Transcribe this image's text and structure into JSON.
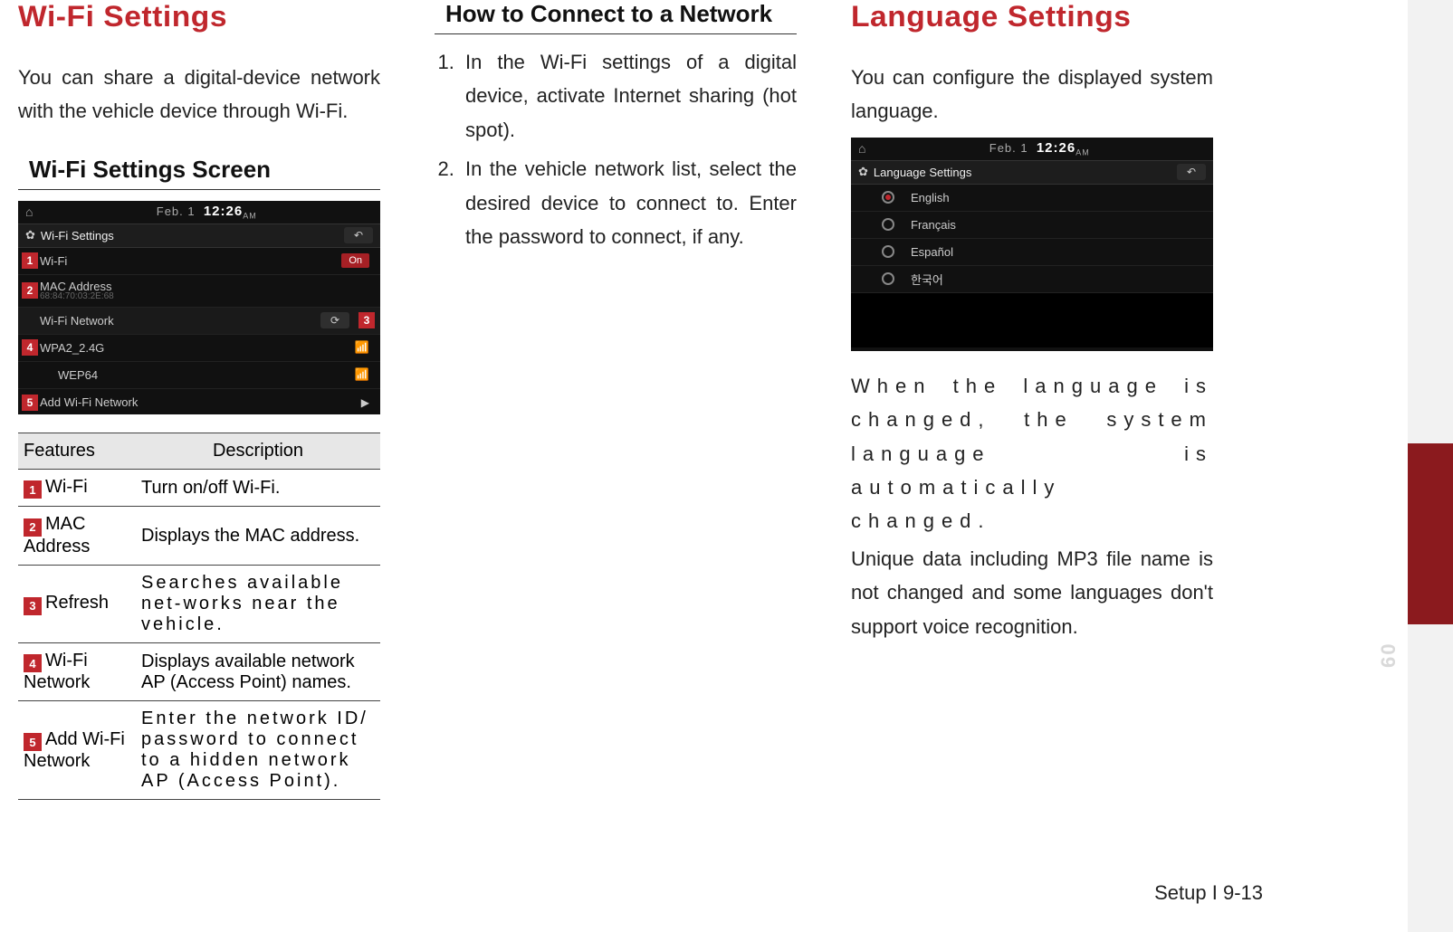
{
  "col1": {
    "title": "Wi-Fi Settings",
    "intro": "You can share a digital-device network with the vehicle device through Wi-Fi.",
    "subheading": "Wi-Fi Settings Screen",
    "screenshot": {
      "date_prefix": "Feb.  1",
      "time": "12:26",
      "time_suffix": "AM",
      "title": "Wi-Fi Settings",
      "row_wifi": "Wi-Fi",
      "wifi_state": "On",
      "row_mac": "MAC Address",
      "mac_value": "68:84:70:03:2E:68",
      "network_header": "Wi-Fi Network",
      "net1": "WPA2_2.4G",
      "net2": "WEP64",
      "add": "Add Wi-Fi Network"
    },
    "table": {
      "head_features": "Features",
      "head_desc": "Description",
      "rows": [
        {
          "num": "1",
          "feature": "Wi-Fi",
          "desc": "Turn on/off Wi-Fi."
        },
        {
          "num": "2",
          "feature": "MAC Address",
          "desc": "Displays the MAC address."
        },
        {
          "num": "3",
          "feature": "Refresh",
          "desc": "Searches available net-works near the vehicle."
        },
        {
          "num": "4",
          "feature": "Wi-Fi Network",
          "desc": "Displays available network AP (Access Point) names."
        },
        {
          "num": "5",
          "feature": "Add Wi-Fi Network",
          "desc": "Enter the network ID/ password to connect to a hidden network AP (Access Point)."
        }
      ]
    }
  },
  "col2": {
    "subheading": "How to Connect to a Network",
    "steps": [
      "In the Wi-Fi settings of a digital device, activate Internet sharing (hot spot).",
      "In the vehicle network list, select the desired device to connect to. Enter the password to connect, if any."
    ]
  },
  "col3": {
    "title": "Language Settings",
    "intro": "You can configure the displayed system language.",
    "screenshot": {
      "date_prefix": "Feb.  1",
      "time": "12:26",
      "time_suffix": "AM",
      "title": "Language Settings",
      "opts": [
        "English",
        "Français",
        "Español",
        "한국어"
      ]
    },
    "body1": "When the language is changed, the system language is automatically changed.",
    "body2": "Unique data including MP3 file name is not changed and some languages don't support voice recognition."
  },
  "side_num": "09",
  "footer": "Setup I 9-13"
}
